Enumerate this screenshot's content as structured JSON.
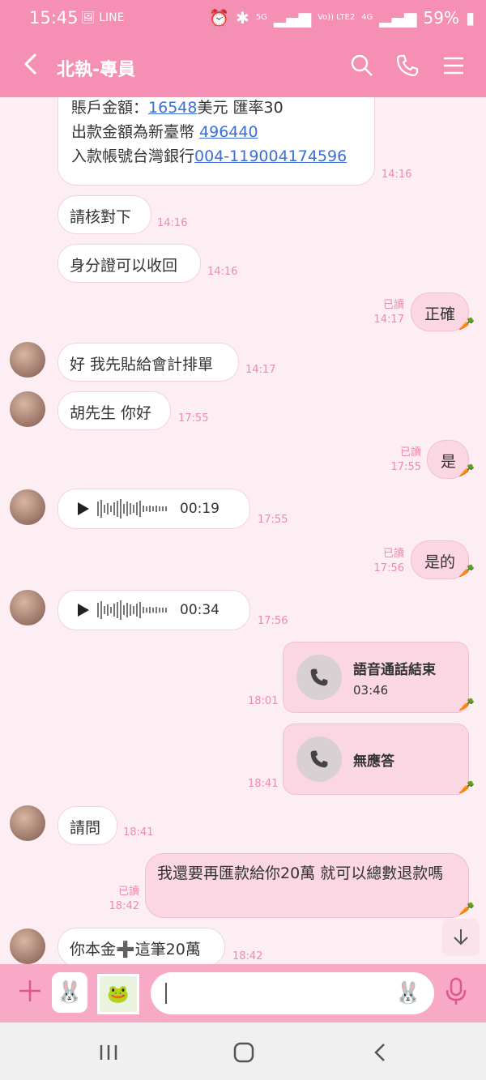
{
  "status": {
    "time": "15:45",
    "network_5g": "5G",
    "volte": "Vo)) LTE2",
    "net_4g": "4G",
    "battery": "59%"
  },
  "header": {
    "title": "北執-專員",
    "icons": [
      "back-arrow",
      "search-icon",
      "phone-icon",
      "menu-icon"
    ]
  },
  "messages": {
    "m1_line1_prefix": "賬戶金額：",
    "m1_amount": "16548",
    "m1_line1_suffix": "美元 匯率30",
    "m1_line2_prefix": "出款金額為新臺幣 ",
    "m1_amount2": "496440",
    "m1_line3_prefix": "入款帳號台灣銀行",
    "m1_account": "004-119004174596",
    "m1_time": "14:16",
    "m2": "請核對下",
    "m2_time": "14:16",
    "m3": "身分證可以收回",
    "m3_time": "14:16",
    "m4": "正確",
    "m4_read": "已讀",
    "m4_time": "14:17",
    "m5": "好 我先貼給會計排單",
    "m5_time": "14:17",
    "m6": "胡先生 你好",
    "m6_time": "17:55",
    "m7": "是",
    "m7_read": "已讀",
    "m7_time": "17:55",
    "m8_duration": "00:19",
    "m8_time": "17:55",
    "m9": "是的",
    "m9_read": "已讀",
    "m9_time": "17:56",
    "m10_duration": "00:34",
    "m10_time": "17:56",
    "m11_title": "語音通話結束",
    "m11_duration": "03:46",
    "m11_time": "18:01",
    "m12_title": "無應答",
    "m12_time": "18:41",
    "m13": "請問",
    "m13_time": "18:41",
    "m14": "我還要再匯款給你20萬 就可以總數退款嗎",
    "m14_read": "已讀",
    "m14_time": "18:42",
    "m15": "你本金➕這筆20萬",
    "m15_time": "18:42"
  },
  "input": {
    "placeholder": ""
  },
  "colors": {
    "header": "#f58fb4",
    "background": "#fdeef3",
    "my_bubble": "#fbd6e3",
    "timestamp": "#f08aab",
    "link": "#3b6fd6"
  }
}
